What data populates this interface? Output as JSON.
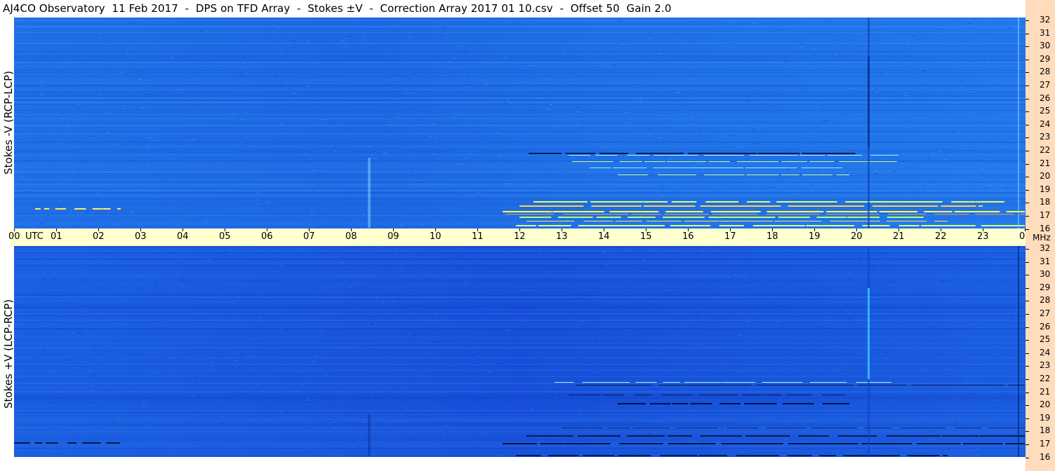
{
  "title": "AJ4CO Observatory  11 Feb 2017  -  DPS on TFD Array  -  Stokes ±V  -  Correction Array 2017 01 10.csv  -  Offset 50  Gain 2.0",
  "panels": [
    {
      "label": "Stokes -V (RCP-LCP)"
    },
    {
      "label": "Stokes +V (LCP-RCP)"
    }
  ],
  "colors": {
    "background": "#1a55e0",
    "time_strip": "#ffffd0",
    "freq_strip": "#ffdcbc"
  },
  "chart_data": {
    "type": "heatmap",
    "title": "AJ4CO Observatory  11 Feb 2017  -  DPS on TFD Array  -  Stokes ±V  -  Correction Array 2017 01 10.csv  -  Offset 50  Gain 2.0",
    "x_axis": {
      "unit_label": "UTC",
      "ticks": [
        "00",
        "01",
        "02",
        "03",
        "04",
        "05",
        "06",
        "07",
        "08",
        "09",
        "10",
        "11",
        "12",
        "13",
        "14",
        "15",
        "16",
        "17",
        "18",
        "19",
        "20",
        "21",
        "22",
        "23",
        "00"
      ],
      "range": [
        0,
        24
      ]
    },
    "y_axis": {
      "unit_label": "MHz",
      "ticks": [
        "32",
        "31",
        "30",
        "29",
        "28",
        "27",
        "26",
        "25",
        "24",
        "23",
        "22",
        "21",
        "20",
        "19",
        "18",
        "17",
        "16"
      ],
      "range": [
        16,
        32
      ]
    },
    "panels": [
      {
        "name": "Stokes -V (RCP-LCP)"
      },
      {
        "name": "Stokes +V (LCP-RCP)"
      }
    ]
  }
}
